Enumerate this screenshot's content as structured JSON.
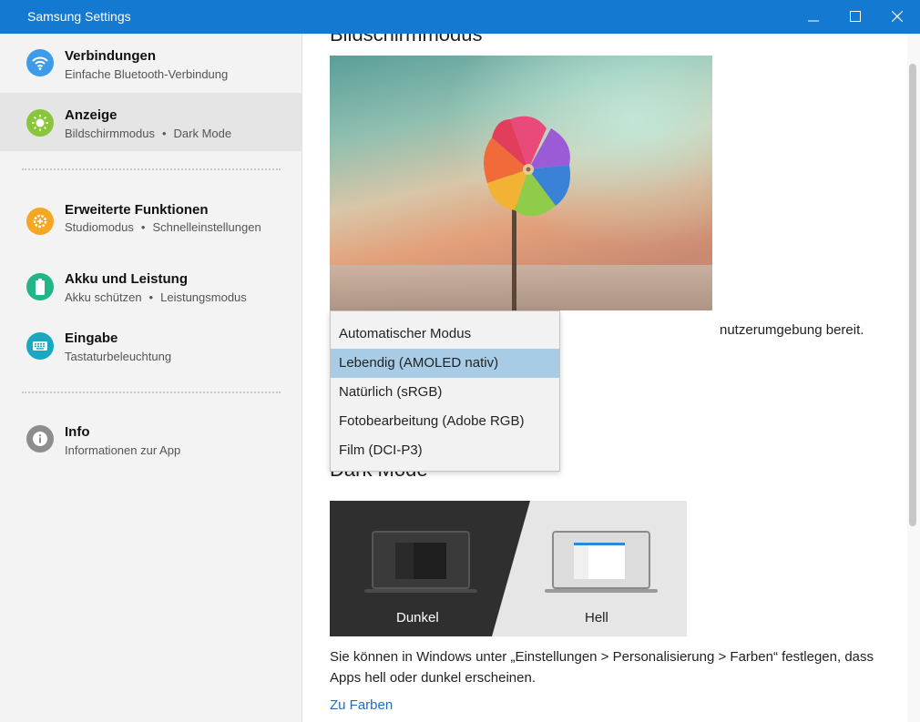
{
  "window": {
    "title": "Samsung Settings",
    "accent_color": "#1479d0"
  },
  "sidebar": {
    "items": [
      {
        "title": "Verbindungen",
        "subtitle": [
          "Einfache Bluetooth-Verbindung"
        ],
        "icon": "wifi-icon",
        "icon_color": "#3d9be9",
        "active": false
      },
      {
        "title": "Anzeige",
        "subtitle": [
          "Bildschirmmodus",
          "Dark Mode"
        ],
        "icon": "brightness-icon",
        "icon_color": "#8ac63c",
        "active": true
      },
      {
        "title": "Erweiterte Funktionen",
        "subtitle": [
          "Studiomodus",
          "Schnelleinstellungen"
        ],
        "icon": "gear-plus-icon",
        "icon_color": "#f5a623",
        "active": false
      },
      {
        "title": "Akku und Leistung",
        "subtitle": [
          "Akku schützen",
          "Leistungsmodus"
        ],
        "icon": "battery-icon",
        "icon_color": "#22b58a",
        "active": false
      },
      {
        "title": "Eingabe",
        "subtitle": [
          "Tastaturbeleuchtung"
        ],
        "icon": "keyboard-icon",
        "icon_color": "#1aa7c2",
        "active": false
      },
      {
        "title": "Info",
        "subtitle": [
          "Informationen zur App"
        ],
        "icon": "info-icon",
        "icon_color": "#8d8d8d",
        "active": false
      }
    ],
    "separator": "•"
  },
  "content": {
    "display_mode_heading": "Bildschirmmodus",
    "display_mode_desc_visible": "nutzerumgebung bereit.",
    "dark_mode_heading": "Dark Mode",
    "dark_option_label": "Dunkel",
    "light_option_label": "Hell",
    "dark_mode_info": "Sie können in Windows unter „Einstellungen > Personalisierung > Farben“ festlegen, dass Apps hell oder dunkel erscheinen.",
    "link_label": "Zu Farben"
  },
  "dropdown": {
    "options": [
      "Automatischer Modus",
      "Lebendig (AMOLED nativ)",
      "Natürlich (sRGB)",
      "Fotobearbeitung (Adobe RGB)",
      "Film (DCI-P3)"
    ],
    "selected": "Lebendig (AMOLED nativ)",
    "highlight_color": "#a9cce6"
  }
}
